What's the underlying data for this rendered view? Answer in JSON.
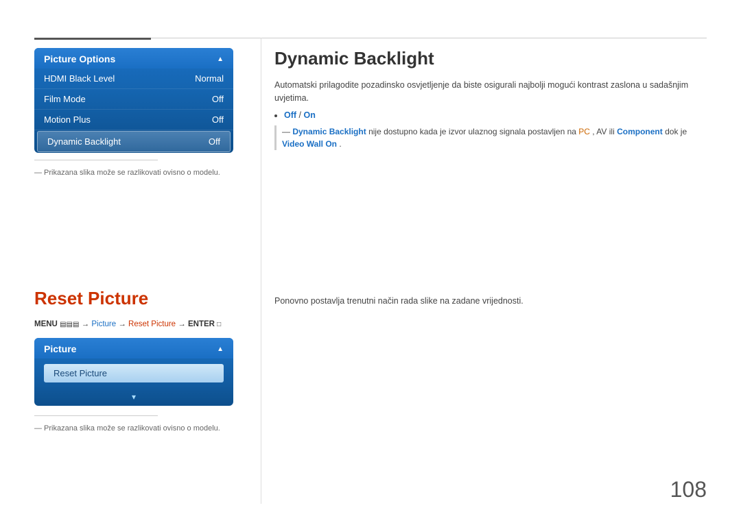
{
  "page": {
    "number": "108"
  },
  "top_divider": {},
  "section1": {
    "title": "Dynamic Backlight",
    "description": "Automatski prilagodite pozadinsko osvjetljenje da biste osigurali najbolji mogući kontrast zaslona u sadašnjim uvjetima.",
    "bullet": "Off / On",
    "warning_prefix": "─ ",
    "warning_highlight": "Dynamic Backlight",
    "warning_text": " nije dostupno kada je izvor ulaznog signala postavljen na ",
    "warning_pc": "PC",
    "warning_comma1": ", AV ili ",
    "warning_component": "Component",
    "warning_text2": " dok je ",
    "warning_videowall": "Video Wall On",
    "warning_end": ".",
    "menu": {
      "title": "Picture Options",
      "arrow_up": "▲",
      "items": [
        {
          "label": "HDMI Black Level",
          "value": "Normal",
          "active": false
        },
        {
          "label": "Film Mode",
          "value": "Off",
          "active": false
        },
        {
          "label": "Motion Plus",
          "value": "Off",
          "active": false
        },
        {
          "label": "Dynamic Backlight",
          "value": "Off",
          "active": true
        }
      ]
    },
    "note": "― Prikazana slika može se razlikovati ovisno o modelu."
  },
  "section2": {
    "title": "Reset Picture",
    "description": "Ponovno postavlja trenutni način rada slike na zadane vrijednosti.",
    "breadcrumb": {
      "menu_label": "MENU",
      "menu_icon": "☰",
      "arrow1": "→",
      "picture_label": "Picture",
      "arrow2": "→",
      "reset_label": "Reset Picture",
      "arrow3": "→",
      "enter_label": "ENTER",
      "enter_icon": "↵"
    },
    "menu": {
      "title": "Picture",
      "arrow_up": "▲",
      "arrow_down": "▾",
      "items": [
        {
          "label": "Reset Picture"
        }
      ]
    },
    "note": "― Prikazana slika može se razlikovati ovisno o modelu."
  }
}
